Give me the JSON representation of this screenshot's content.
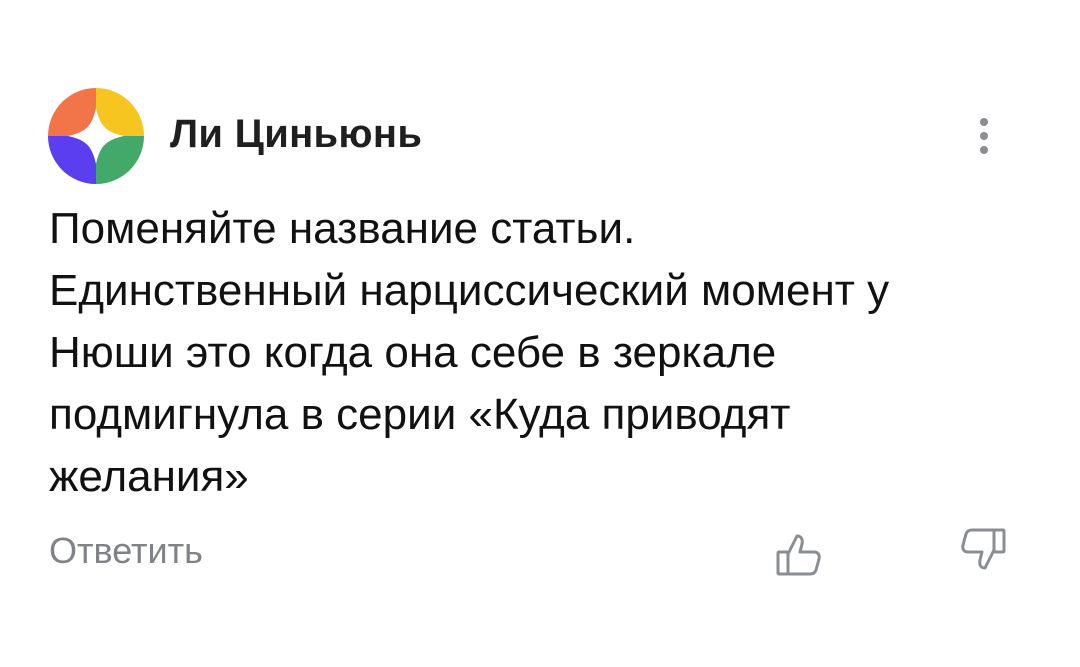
{
  "comment": {
    "author": "Ли Циньюнь",
    "text_lines": [
      "Поменяйте название статьи.",
      "Единственный нарциссический момент у",
      "Нюши это когда она себе в зеркале",
      "подмигнула в серии «Куда приводят",
      "желания»"
    ],
    "reply_label": "Ответить",
    "avatar_colors": [
      "#f2754a",
      "#f7c520",
      "#5b3ef0",
      "#43a96a"
    ],
    "icons": {
      "more": "more-vertical-icon",
      "like": "thumbs-up-icon",
      "dislike": "thumbs-down-icon"
    }
  }
}
